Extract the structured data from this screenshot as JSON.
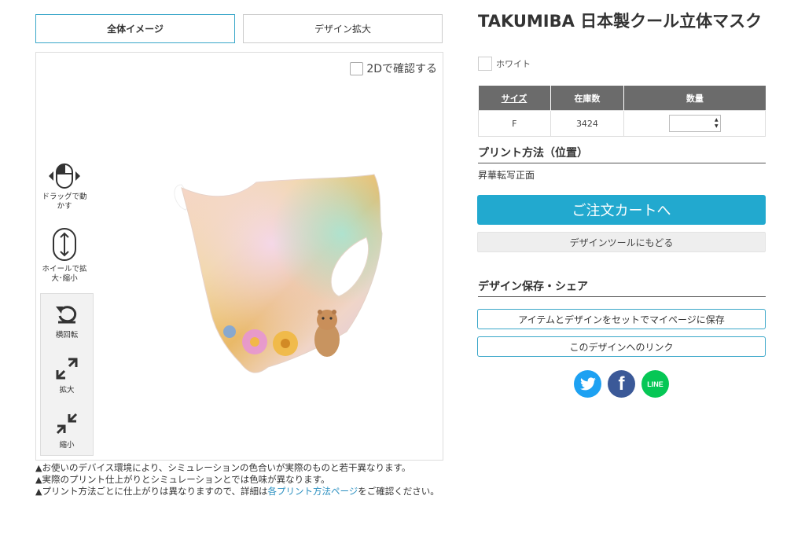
{
  "tabs": [
    {
      "label": "全体イメージ"
    },
    {
      "label": "デザイン拡大"
    }
  ],
  "viewer": {
    "check_2d_label": "2Dで確認する",
    "controls": {
      "drag": "ドラッグで動かす",
      "wheel": "ホイールで拡大･縮小"
    },
    "tools": {
      "rotate": "横回転",
      "zoom_in": "拡大",
      "zoom_out": "縮小"
    }
  },
  "notes": {
    "note1": "お使いのデバイス環境により、シミュレーションの色合いが実際のものと若干異なります。",
    "note2": "実際のプリント仕上がりとシミュレーションとでは色味が異なります。",
    "note3_before": "プリント方法ごとに仕上がりは異なりますので、詳細は",
    "note3_link": "各プリント方法ページ",
    "note3_after": "をご確認ください。"
  },
  "product": {
    "title": "TAKUMIBA 日本製クール立体マスク",
    "color_name": "ホワイト"
  },
  "stock_table": {
    "headers": {
      "size": "サイズ",
      "stock": "在庫数",
      "quantity": "数量"
    },
    "rows": [
      {
        "size": "F",
        "stock": "3424",
        "quantity": ""
      }
    ]
  },
  "print": {
    "section_title": "プリント方法（位置）",
    "method": "昇華転写正面"
  },
  "buttons": {
    "cart": "ご注文カートへ",
    "back": "デザインツールにもどる",
    "save": "アイテムとデザインをセットでマイページに保存",
    "link": "このデザインへのリンク"
  },
  "share": {
    "section_title": "デザイン保存・シェア",
    "icons": [
      "twitter-icon",
      "facebook-icon",
      "line-icon"
    ],
    "line_label": "LINE"
  },
  "colors": {
    "accent": "#22a9cf",
    "twitter": "#1da1f2",
    "facebook": "#3b5998",
    "line": "#06c755",
    "table_header": "#6b6b6b"
  }
}
